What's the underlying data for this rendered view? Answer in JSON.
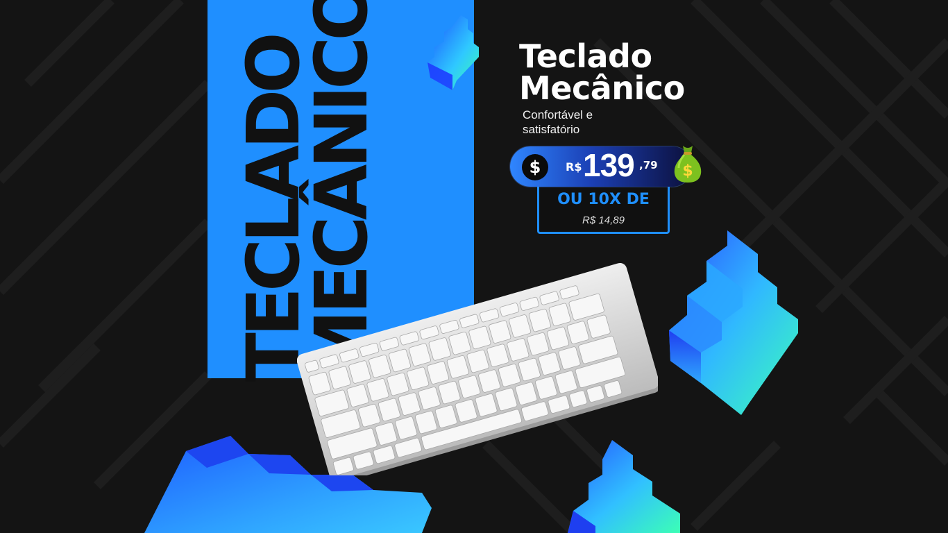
{
  "vertical": {
    "line1": "TECLADO",
    "line2": "MECÂNICO"
  },
  "title": {
    "line1": "Teclado",
    "line2": "Mecânico"
  },
  "subtitle": {
    "line1": "Confortável e",
    "line2": "satisfatório"
  },
  "price": {
    "icon_symbol": "$",
    "currency": "R$",
    "amount": "139",
    "cents": ",79",
    "bag_symbol": "$"
  },
  "installments": {
    "label": "OU 10X DE",
    "value": "R$ 14,89"
  },
  "colors": {
    "background": "#141414",
    "accent_blue": "#1f8fff",
    "text_white": "#ffffff",
    "bag_green": "#7dc11f"
  },
  "icons": [
    "dollar-icon",
    "money-bag-icon",
    "keyboard-image",
    "stairs-decoration"
  ]
}
